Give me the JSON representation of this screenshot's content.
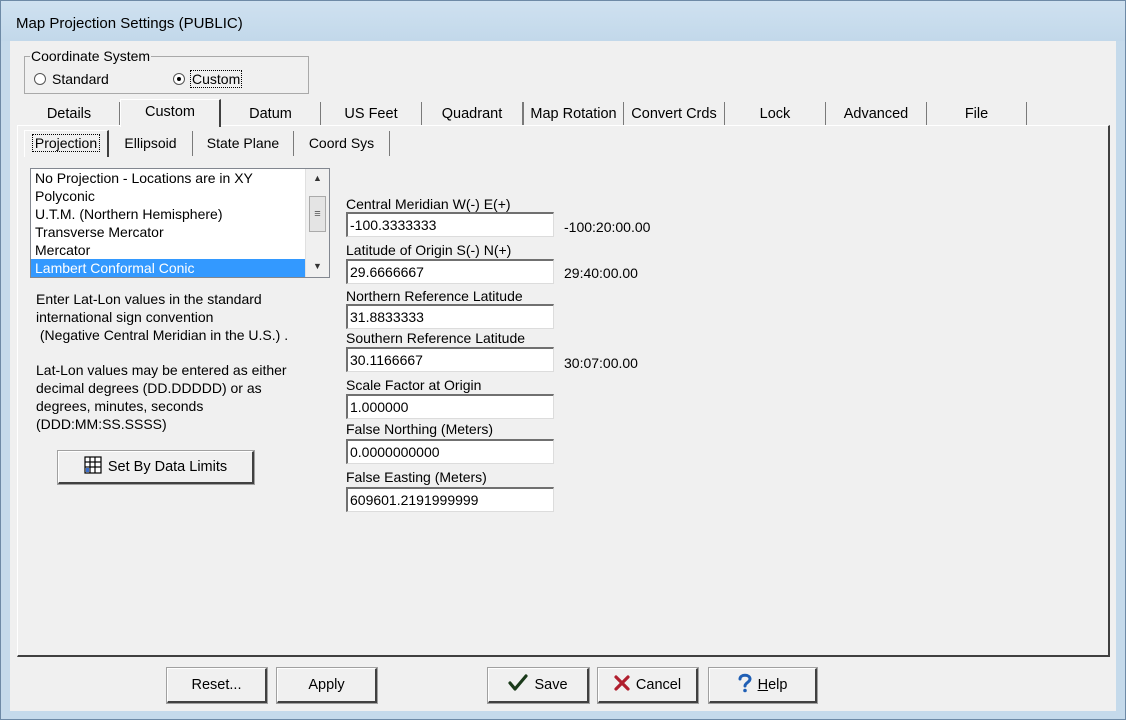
{
  "window": {
    "title": "Map Projection Settings (PUBLIC)"
  },
  "coordinate_system": {
    "legend": "Coordinate System",
    "options": [
      {
        "label": "Standard",
        "checked": false
      },
      {
        "label": "Custom",
        "checked": true
      }
    ]
  },
  "tabs": [
    "Details",
    "Custom",
    "Datum",
    "US Feet",
    "Quadrant",
    "Map Rotation",
    "Convert Crds",
    "Lock",
    "Advanced",
    "File"
  ],
  "active_tab": "Custom",
  "subtabs": [
    "Projection",
    "Ellipsoid",
    "State Plane",
    "Coord Sys"
  ],
  "active_subtab": "Projection",
  "projection_list": {
    "items": [
      "No Projection - Locations are in XY",
      "Polyconic",
      "U.T.M. (Northern Hemisphere)",
      "Transverse Mercator",
      "Mercator",
      "Lambert Conformal Conic"
    ],
    "selected": "Lambert Conformal Conic"
  },
  "info": {
    "para1": "Enter Lat-Lon values in the standard\ninternational sign convention\n (Negative Central Meridian in the U.S.) .",
    "para2": "Lat-Lon values may be entered as either\ndecimal degrees (DD.DDDDD) or as\ndegrees, minutes, seconds\n(DDD:MM:SS.SSSS)"
  },
  "set_by_data_limits": {
    "label": "Set By Data Limits",
    "icon": "grid-icon"
  },
  "fields": {
    "central_meridian": {
      "label": "Central Meridian W(-) E(+)",
      "value": "-100.3333333",
      "dms": "-100:20:00.00"
    },
    "latitude_origin": {
      "label": "Latitude of Origin S(-) N(+)",
      "value": "29.6666667",
      "dms": "29:40:00.00"
    },
    "northern_ref": {
      "label": "Northern Reference Latitude",
      "value": "31.8833333",
      "dms": ""
    },
    "southern_ref": {
      "label": "Southern Reference Latitude",
      "value": "30.1166667",
      "dms": "30:07:00.00"
    },
    "scale_factor": {
      "label": "Scale Factor at Origin",
      "value": "1.000000"
    },
    "false_northing": {
      "label": "False Northing  (Meters)",
      "value": "0.0000000000"
    },
    "false_easting": {
      "label": "False Easting  (Meters)",
      "value": "609601.2191999999"
    }
  },
  "buttons": {
    "reset": "Reset...",
    "apply": "Apply",
    "save": "Save",
    "cancel": "Cancel",
    "help_prefix": "H",
    "help_rest": "elp"
  },
  "colors": {
    "selection": "#3399ff",
    "save_check": "#1a3a1a",
    "cancel_x": "#b01e2e",
    "help_icon": "#1f5fb5"
  }
}
